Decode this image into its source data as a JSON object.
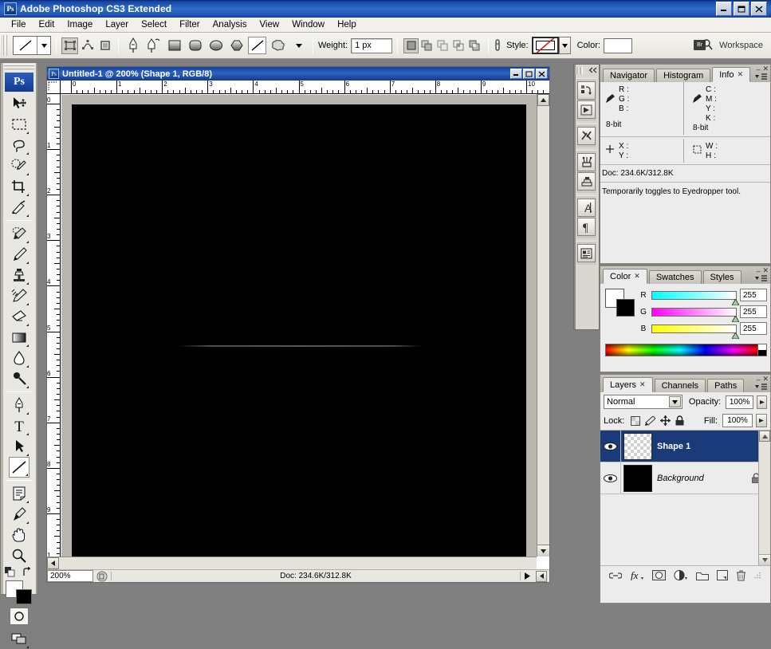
{
  "window": {
    "title": "Adobe Photoshop CS3 Extended",
    "app_icon": "photoshop-icon",
    "minimize": "_",
    "maximize": "❐",
    "close": "✕"
  },
  "menubar": {
    "items": [
      {
        "label": "File"
      },
      {
        "label": "Edit"
      },
      {
        "label": "Image"
      },
      {
        "label": "Layer"
      },
      {
        "label": "Select"
      },
      {
        "label": "Filter"
      },
      {
        "label": "Analysis"
      },
      {
        "label": "View"
      },
      {
        "label": "Window"
      },
      {
        "label": "Help"
      }
    ]
  },
  "options_bar": {
    "tool_preset_icon": "line-tool-icon",
    "mode_buttons": [
      {
        "name": "shape-layers",
        "selected": true
      },
      {
        "name": "paths",
        "selected": false
      },
      {
        "name": "fill-pixels",
        "selected": false
      }
    ],
    "geometry_buttons": [
      {
        "name": "pen-tool",
        "selected": false
      },
      {
        "name": "freeform-pen-tool",
        "selected": false
      },
      {
        "name": "rectangle-tool",
        "selected": false
      },
      {
        "name": "rounded-rectangle-tool",
        "selected": false
      },
      {
        "name": "ellipse-tool",
        "selected": false
      },
      {
        "name": "polygon-tool",
        "selected": false
      },
      {
        "name": "line-tool",
        "selected": true
      },
      {
        "name": "custom-shape-tool",
        "selected": false
      }
    ],
    "weight_label": "Weight:",
    "weight_value": "1 px",
    "area_buttons": [
      {
        "name": "create-new-shape-layer",
        "selected": true
      },
      {
        "name": "add-to-shape-area",
        "selected": false
      },
      {
        "name": "subtract-from-shape-area",
        "selected": false
      },
      {
        "name": "intersect-shape-areas",
        "selected": false
      },
      {
        "name": "exclude-overlapping-shape-areas",
        "selected": false
      }
    ],
    "link_icon": "link-icon",
    "style_label": "Style:",
    "style_value_icon": "no-style-icon",
    "color_label": "Color:",
    "color_value": "#ffffff",
    "bridge_icon_label": "Br",
    "workspace_label": "Workspace"
  },
  "toolbox": {
    "logo": "Ps",
    "tools": [
      {
        "name": "move-tool",
        "has_submenu": false
      },
      {
        "name": "rectangular-marquee-tool",
        "has_submenu": true
      },
      {
        "name": "lasso-tool",
        "has_submenu": true
      },
      {
        "name": "quick-selection-tool",
        "has_submenu": true
      },
      {
        "name": "crop-tool",
        "has_submenu": true
      },
      {
        "name": "slice-tool",
        "has_submenu": true
      },
      {
        "name": "spot-healing-brush-tool",
        "has_submenu": true
      },
      {
        "name": "brush-tool",
        "has_submenu": true
      },
      {
        "name": "clone-stamp-tool",
        "has_submenu": true
      },
      {
        "name": "history-brush-tool",
        "has_submenu": true
      },
      {
        "name": "eraser-tool",
        "has_submenu": true
      },
      {
        "name": "gradient-tool",
        "has_submenu": true
      },
      {
        "name": "blur-tool",
        "has_submenu": true
      },
      {
        "name": "dodge-tool",
        "has_submenu": true
      },
      {
        "name": "pen-tool",
        "has_submenu": true
      },
      {
        "name": "horizontal-type-tool",
        "has_submenu": true
      },
      {
        "name": "path-selection-tool",
        "has_submenu": true
      },
      {
        "name": "line-tool",
        "has_submenu": true,
        "selected": true
      },
      {
        "name": "notes-tool",
        "has_submenu": true
      },
      {
        "name": "eyedropper-tool",
        "has_submenu": true
      },
      {
        "name": "hand-tool",
        "has_submenu": false
      },
      {
        "name": "zoom-tool",
        "has_submenu": false
      }
    ],
    "foreground_color": "#ffffff",
    "background_color": "#000000",
    "default-colors-icon": "default-colors-icon",
    "swap-colors-icon": "swap-colors-icon",
    "quick-mask-icon": "quick-mask-icon",
    "screen-mode-icon": "screen-mode-icon"
  },
  "document": {
    "title": "Untitled-1 @ 200% (Shape 1, RGB/8)",
    "minimize": "_",
    "maximize": "❐",
    "close": "✕",
    "ruler_units_h": [
      "0",
      "1",
      "2",
      "3",
      "4",
      "5",
      "6",
      "7",
      "8",
      "9",
      "10"
    ],
    "ruler_units_v": [
      "0",
      "1",
      "2",
      "3",
      "4",
      "5",
      "6",
      "7",
      "8",
      "9",
      "1"
    ],
    "zoom": "200%",
    "doc_size": "Doc: 234.6K/312.8K",
    "canvas_background": "#000000",
    "shape_name": "Shape 1"
  },
  "dock_strip": {
    "collapse_icon": "double-chevron-left-icon",
    "buttons": [
      {
        "name": "history-panel-icon"
      },
      {
        "name": "actions-panel-icon"
      },
      {
        "name": "tool-presets-panel-icon"
      },
      {
        "name": "brushes-panel-icon"
      },
      {
        "name": "clone-source-panel-icon"
      },
      {
        "name": "character-panel-icon"
      },
      {
        "name": "paragraph-panel-icon"
      },
      {
        "name": "layer-comps-panel-icon"
      }
    ]
  },
  "info_panel": {
    "tabs": [
      {
        "label": "Navigator",
        "active": false,
        "closable": false
      },
      {
        "label": "Histogram",
        "active": false,
        "closable": false
      },
      {
        "label": "Info",
        "active": true,
        "closable": true
      }
    ],
    "rgb_readout": {
      "icon": "eyedropper-icon",
      "rows": [
        "R :",
        "G :",
        "B :"
      ],
      "depth": "8-bit"
    },
    "cmyk_readout": {
      "icon": "eyedropper-icon",
      "rows": [
        "C :",
        "M :",
        "Y :",
        "K :"
      ],
      "depth": "8-bit"
    },
    "position": {
      "icon": "crosshair-icon",
      "rows": [
        "X :",
        "Y :"
      ]
    },
    "dimensions": {
      "icon": "marquee-icon",
      "rows": [
        "W :",
        "H :"
      ]
    },
    "doc_size": "Doc: 234.6K/312.8K",
    "hint": "Temporarily toggles to Eyedropper tool."
  },
  "color_panel": {
    "tabs": [
      {
        "label": "Color",
        "active": true,
        "closable": true
      },
      {
        "label": "Swatches",
        "active": false,
        "closable": false
      },
      {
        "label": "Styles",
        "active": false,
        "closable": false
      }
    ],
    "foreground_color": "#ffffff",
    "background_color": "#000000",
    "channels": [
      {
        "name": "R",
        "value": "255",
        "track_from": "#00ffff",
        "track_to": "#ffffff"
      },
      {
        "name": "G",
        "value": "255",
        "track_from": "#ff00ff",
        "track_to": "#ffffff"
      },
      {
        "name": "B",
        "value": "255",
        "track_from": "#ffff00",
        "track_to": "#ffffff"
      }
    ]
  },
  "layers_panel": {
    "tabs": [
      {
        "label": "Layers",
        "active": true,
        "closable": true
      },
      {
        "label": "Channels",
        "active": false,
        "closable": false
      },
      {
        "label": "Paths",
        "active": false,
        "closable": false
      }
    ],
    "blend_mode": "Normal",
    "opacity_label": "Opacity:",
    "opacity_value": "100%",
    "lock_label": "Lock:",
    "lock_icons": [
      {
        "name": "lock-transparent-pixels-icon"
      },
      {
        "name": "lock-image-pixels-icon"
      },
      {
        "name": "lock-position-icon"
      },
      {
        "name": "lock-all-icon"
      }
    ],
    "fill_label": "Fill:",
    "fill_value": "100%",
    "layers": [
      {
        "name": "Shape 1",
        "selected": true,
        "visible": true,
        "thumb": "checker",
        "locked": false,
        "italic": false
      },
      {
        "name": "Background",
        "selected": false,
        "visible": true,
        "thumb": "black",
        "locked": true,
        "italic": true
      }
    ],
    "footer_buttons": [
      {
        "name": "link-layers-icon"
      },
      {
        "name": "add-layer-style-icon"
      },
      {
        "name": "add-layer-mask-icon"
      },
      {
        "name": "new-fill-adjustment-layer-icon"
      },
      {
        "name": "new-group-icon"
      },
      {
        "name": "new-layer-icon"
      },
      {
        "name": "delete-layer-icon"
      }
    ]
  },
  "colors": {
    "title_blue": "#2f6ccb",
    "panel_gray": "#ececec",
    "selection_blue": "#1b3a7a",
    "chrome_gray": "#e9e7e1"
  }
}
